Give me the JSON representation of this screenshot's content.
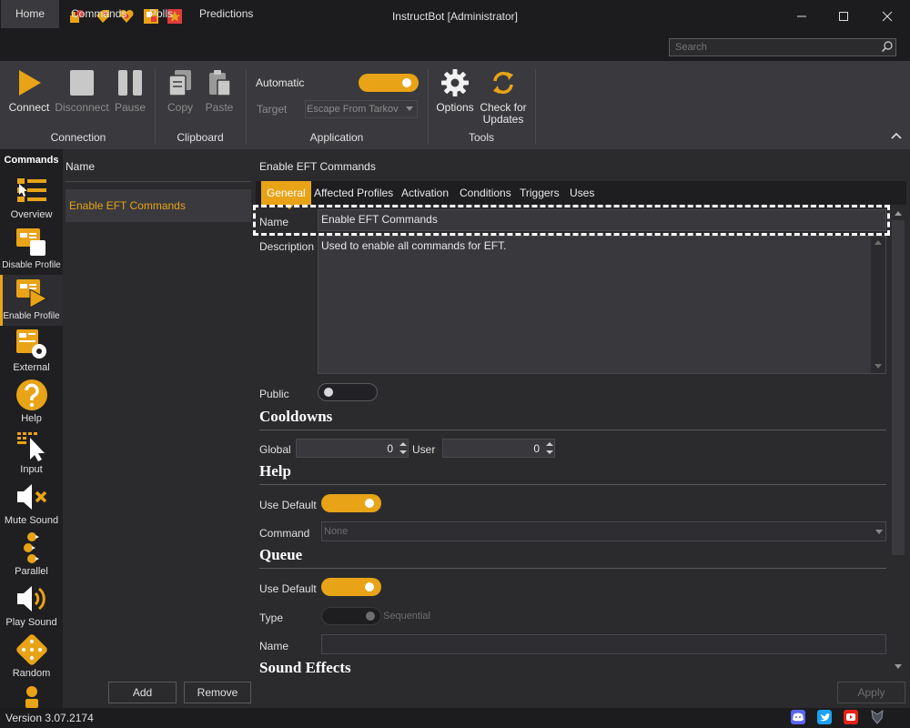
{
  "window": {
    "title": "InstructBot [Administrator]"
  },
  "menu": {
    "tabs": [
      {
        "label": "Home"
      },
      {
        "label": "Commands"
      },
      {
        "label": "Polls"
      },
      {
        "label": "Predictions"
      }
    ],
    "search_placeholder": "Search"
  },
  "ribbon": {
    "connect": "Connect",
    "disconnect": "Disconnect",
    "pause": "Pause",
    "copy": "Copy",
    "paste": "Paste",
    "automatic": "Automatic",
    "target": "Target",
    "target_value": "Escape From Tarkov",
    "options": "Options",
    "check_updates_1": "Check for",
    "check_updates_2": "Updates",
    "groups": {
      "connection": "Connection",
      "clipboard": "Clipboard",
      "application": "Application",
      "tools": "Tools"
    }
  },
  "leftbar": {
    "header": "Commands",
    "items": [
      {
        "label": "Overview"
      },
      {
        "label": "Disable Profile"
      },
      {
        "label": "Enable Profile"
      },
      {
        "label": "External"
      },
      {
        "label": "Help"
      },
      {
        "label": "Input"
      },
      {
        "label": "Mute Sound"
      },
      {
        "label": "Parallel"
      },
      {
        "label": "Play Sound"
      },
      {
        "label": "Random"
      }
    ]
  },
  "list": {
    "header": "Name",
    "rows": [
      {
        "name": "Enable EFT Commands"
      }
    ],
    "add": "Add",
    "remove": "Remove"
  },
  "detail": {
    "title": "Enable EFT Commands",
    "tabs": [
      {
        "label": "General"
      },
      {
        "label": "Affected Profiles"
      },
      {
        "label": "Activation"
      },
      {
        "label": "Conditions"
      },
      {
        "label": "Triggers"
      },
      {
        "label": "Uses"
      }
    ],
    "name_label": "Name",
    "name_value": "Enable EFT Commands",
    "description_label": "Description",
    "description_value": "Used to enable all commands for EFT.",
    "public_label": "Public",
    "cooldowns": {
      "heading": "Cooldowns",
      "global_label": "Global",
      "global_value": "0",
      "user_label": "User",
      "user_value": "0"
    },
    "help": {
      "heading": "Help",
      "use_default_label": "Use Default",
      "command_label": "Command",
      "command_value": "None"
    },
    "queue": {
      "heading": "Queue",
      "use_default_label": "Use Default",
      "type_label": "Type",
      "type_value": "Sequential",
      "name_label": "Name",
      "name_value": ""
    },
    "sound_heading": "Sound Effects",
    "apply": "Apply"
  },
  "status": {
    "version": "Version 3.07.2174"
  },
  "colors": {
    "accent": "#e8a317",
    "background": "#2b2b2e",
    "chrome": "#1c1c1e"
  }
}
